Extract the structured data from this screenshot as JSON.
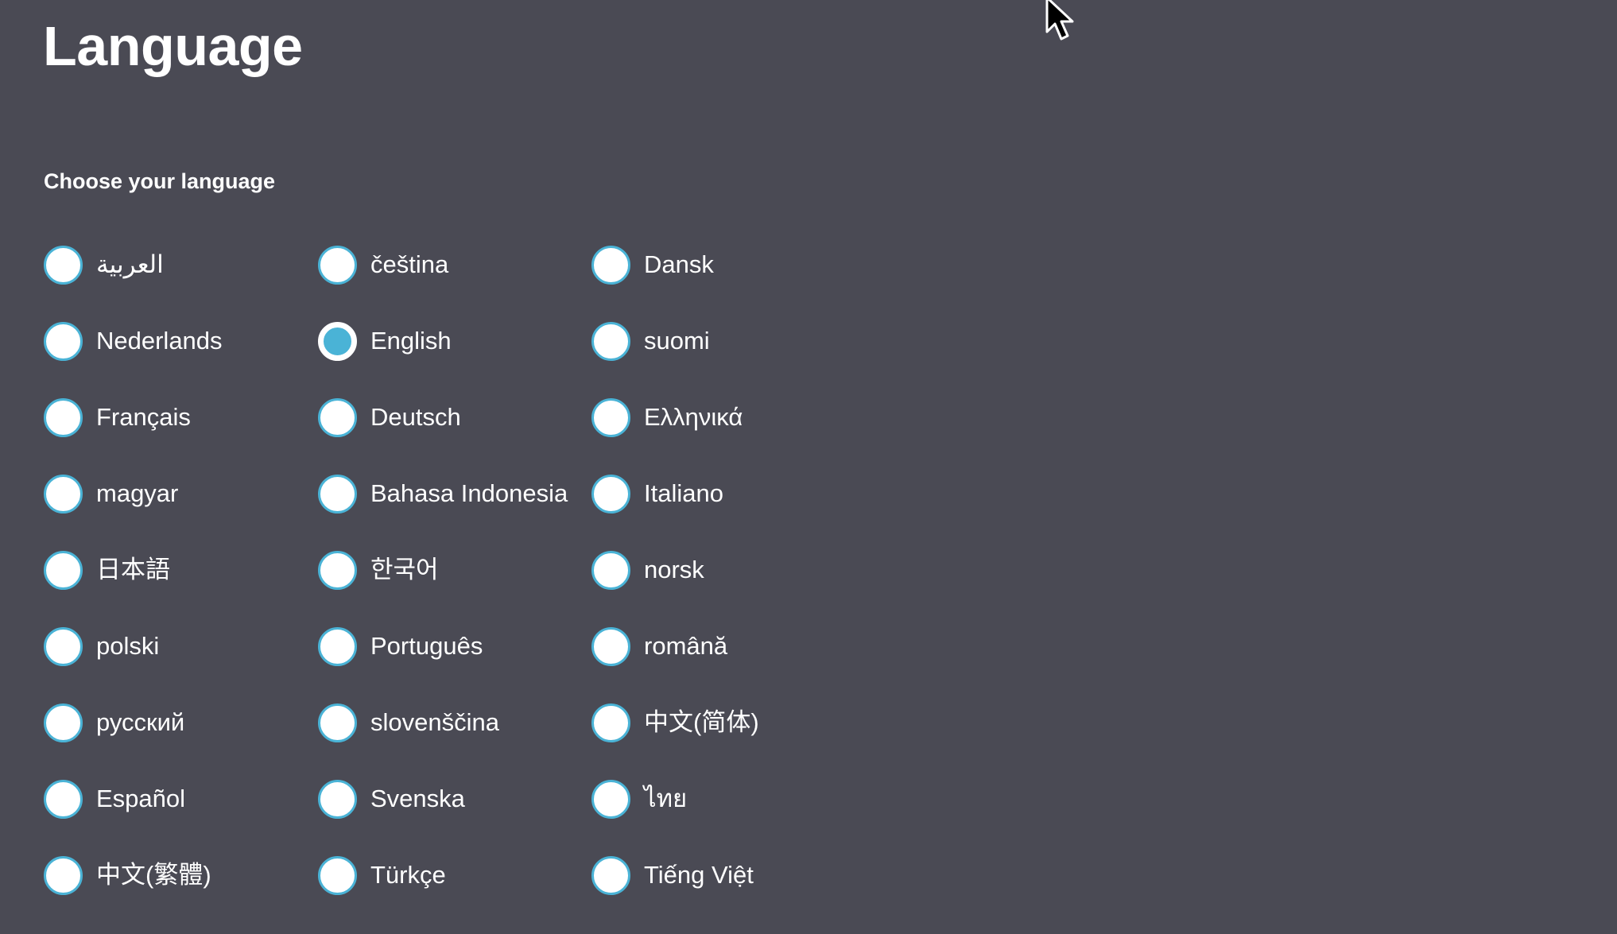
{
  "page": {
    "title": "Language",
    "subtitle": "Choose your language"
  },
  "languages": {
    "selected": "English",
    "options": [
      {
        "label": "العربية",
        "selected": false
      },
      {
        "label": "čeština",
        "selected": false
      },
      {
        "label": "Dansk",
        "selected": false
      },
      {
        "label": "Nederlands",
        "selected": false
      },
      {
        "label": "English",
        "selected": true
      },
      {
        "label": "suomi",
        "selected": false
      },
      {
        "label": "Français",
        "selected": false
      },
      {
        "label": "Deutsch",
        "selected": false
      },
      {
        "label": "Ελληνικά",
        "selected": false
      },
      {
        "label": "magyar",
        "selected": false
      },
      {
        "label": "Bahasa Indonesia",
        "selected": false
      },
      {
        "label": "Italiano",
        "selected": false
      },
      {
        "label": "日本語",
        "selected": false
      },
      {
        "label": "한국어",
        "selected": false
      },
      {
        "label": "norsk",
        "selected": false
      },
      {
        "label": "polski",
        "selected": false
      },
      {
        "label": "Português",
        "selected": false
      },
      {
        "label": "română",
        "selected": false
      },
      {
        "label": "русский",
        "selected": false
      },
      {
        "label": "slovenščina",
        "selected": false
      },
      {
        "label": "中文(简体)",
        "selected": false
      },
      {
        "label": "Español",
        "selected": false
      },
      {
        "label": "Svenska",
        "selected": false
      },
      {
        "label": "ไทย",
        "selected": false
      },
      {
        "label": "中文(繁體)",
        "selected": false
      },
      {
        "label": "Türkçe",
        "selected": false
      },
      {
        "label": "Tiếng Việt",
        "selected": false
      }
    ]
  },
  "colors": {
    "background": "#4a4a54",
    "accent": "#4ab3d6",
    "text": "#ffffff"
  },
  "cursor": {
    "icon": "mouse-pointer-icon"
  }
}
